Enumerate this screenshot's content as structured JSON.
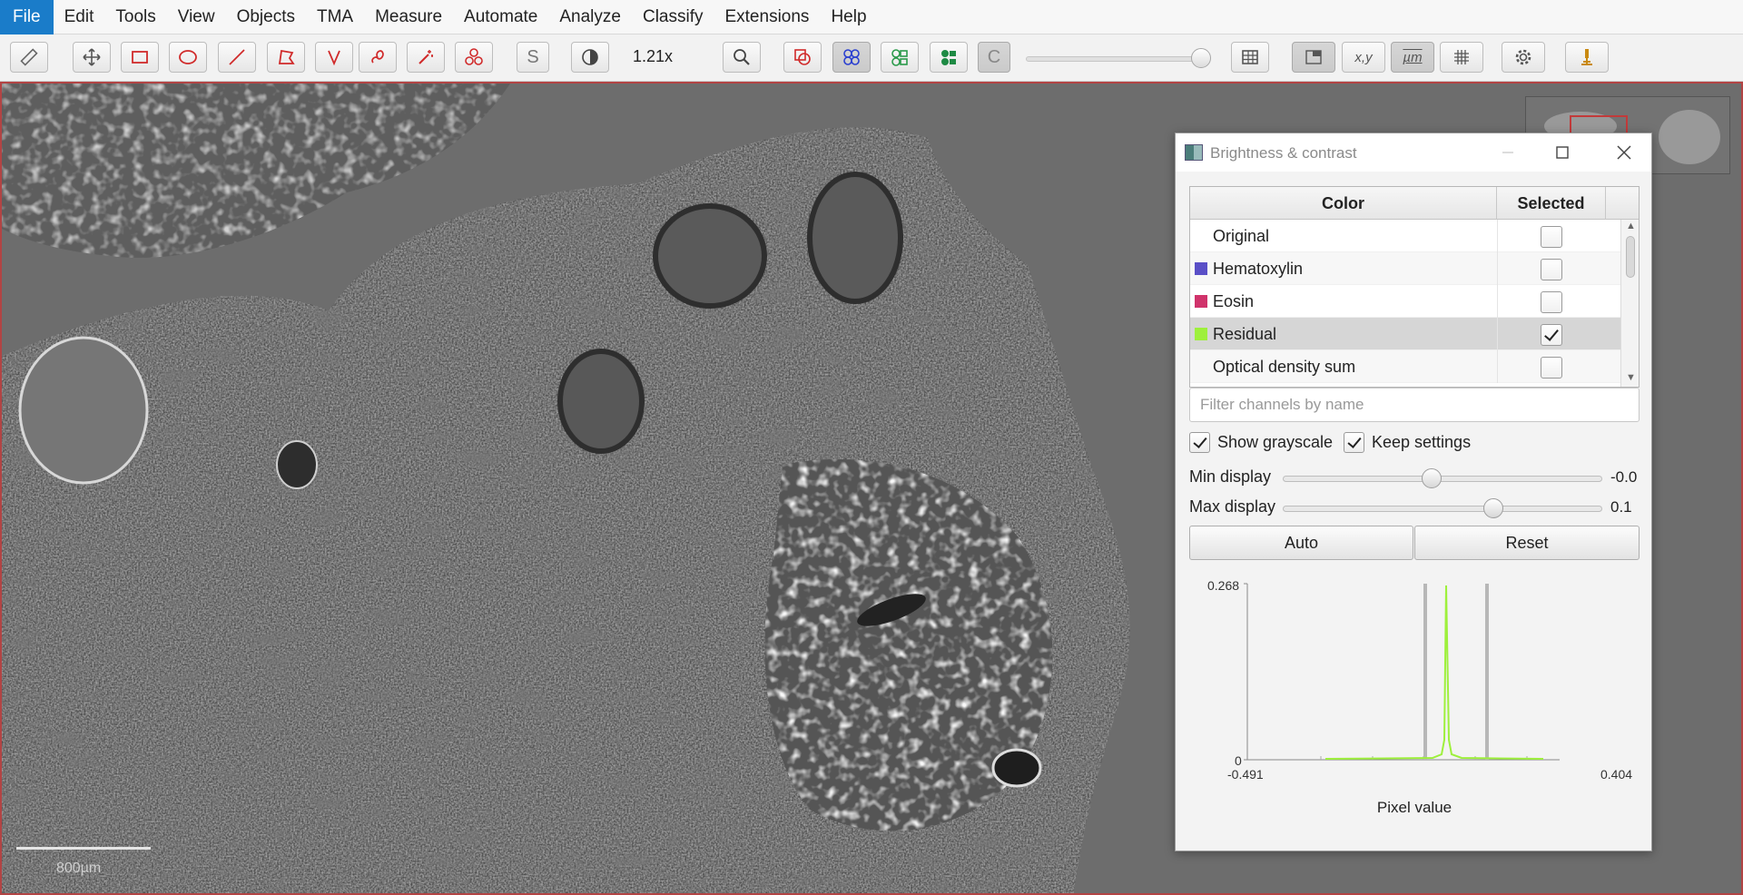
{
  "menubar": {
    "items": [
      "File",
      "Edit",
      "Tools",
      "View",
      "Objects",
      "TMA",
      "Measure",
      "Automate",
      "Analyze",
      "Classify",
      "Extensions",
      "Help"
    ]
  },
  "toolbar": {
    "zoom_level": "1.21x",
    "icons": [
      "ruler-icon",
      "move-icon",
      "rectangle-icon",
      "ellipse-icon",
      "line-icon",
      "polygon-icon",
      "polyline-icon",
      "brush-icon",
      "wand-icon",
      "points-icon",
      "selection-mode-icon",
      "brightness-contrast-icon",
      "zoom-to-fit-icon",
      "show-annotations-icon",
      "show-tma-grid-icon",
      "show-detections-icon",
      "fill-detections-icon",
      "show-pixel-classification-icon",
      "measurement-table-icon",
      "overview-icon",
      "coordinates-icon",
      "scalebar-icon",
      "grid-icon",
      "settings-icon",
      "microscope-icon"
    ],
    "selection_mode_label": "S",
    "pixel_class_label": "C",
    "coords_label": "x,y",
    "scalebar_label": "µm",
    "opacity_value": 1.0
  },
  "viewer": {
    "scalebar_label": "800µm"
  },
  "dialog": {
    "title": "Brightness & contrast",
    "table": {
      "headers": {
        "color": "Color",
        "selected": "Selected"
      },
      "rows": [
        {
          "name": "Original",
          "color": null,
          "selected": false
        },
        {
          "name": "Hematoxylin",
          "color": "#5a4fc7",
          "selected": false
        },
        {
          "name": "Eosin",
          "color": "#d0336b",
          "selected": false
        },
        {
          "name": "Residual",
          "color": "#9ef03c",
          "selected": true
        },
        {
          "name": "Optical density sum",
          "color": null,
          "selected": false
        }
      ]
    },
    "filter_placeholder": "Filter channels by name",
    "show_grayscale": {
      "label": "Show grayscale",
      "checked": true
    },
    "keep_settings": {
      "label": "Keep settings",
      "checked": true
    },
    "min_display": {
      "label": "Min display",
      "value": "-0.0"
    },
    "max_display": {
      "label": "Max display",
      "value": "0.1"
    },
    "auto_button": "Auto",
    "reset_button": "Reset",
    "histogram": {
      "y_max": "0.268",
      "y_min": "0",
      "x_min": "-0.491",
      "x_max": "0.404",
      "x_label": "Pixel value",
      "peak_color": "#9ef03c"
    }
  }
}
